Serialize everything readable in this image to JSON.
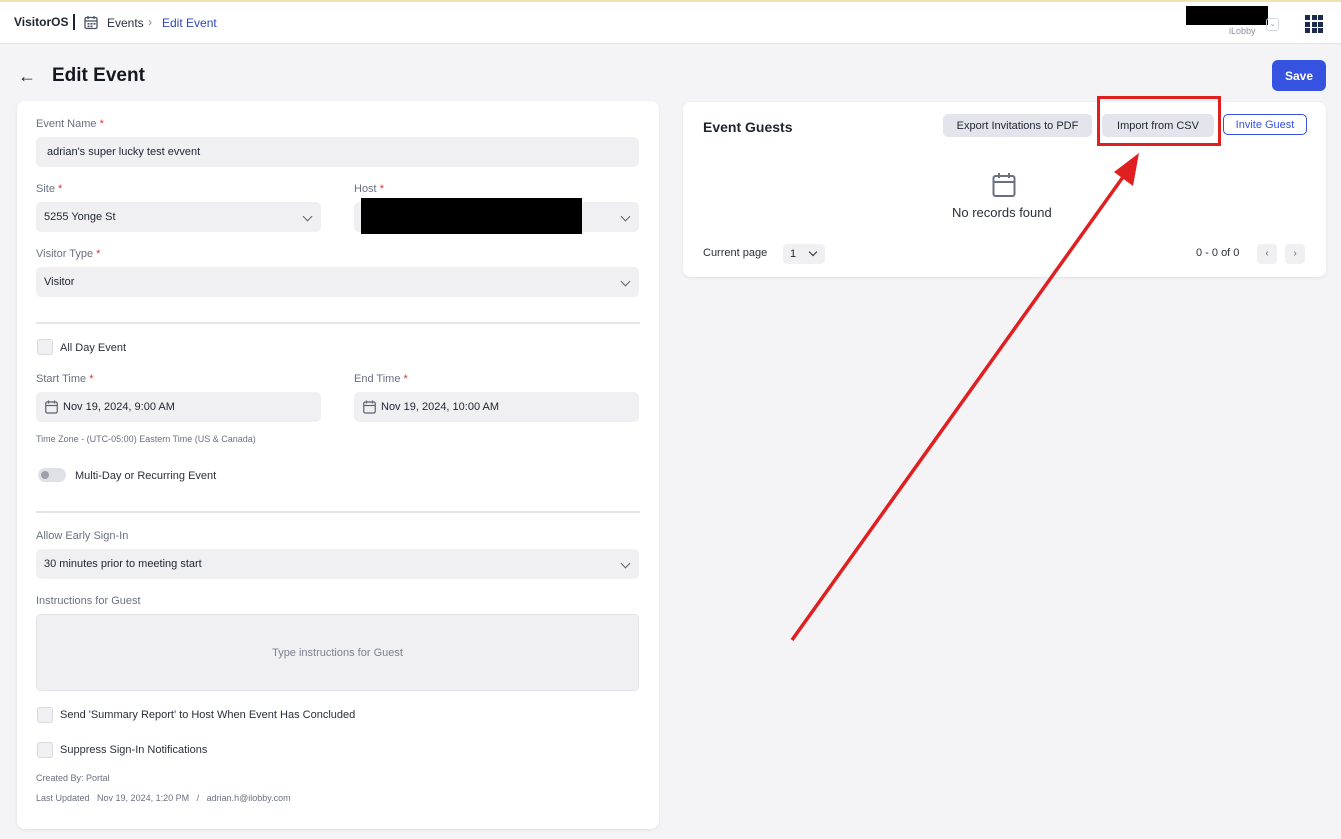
{
  "topbar": {
    "brand": "VisitorOS",
    "breadcrumb_events": "Events",
    "breadcrumb_chevron": "›",
    "breadcrumb_current": "Edit Event",
    "org_label": "iLobby",
    "org_chevron": "⌄"
  },
  "page": {
    "back_arrow": "←",
    "title": "Edit Event",
    "save_label": "Save"
  },
  "form": {
    "event_name_label": "Event Name",
    "event_name_value": "adrian's super lucky test evvent",
    "site_label": "Site",
    "site_value": "5255 Yonge St",
    "host_label": "Host",
    "visitor_type_label": "Visitor Type",
    "visitor_type_value": "Visitor",
    "all_day_label": "All Day Event",
    "start_time_label": "Start Time",
    "start_time_value": "Nov 19, 2024, 9:00 AM",
    "end_time_label": "End Time",
    "end_time_value": "Nov 19, 2024, 10:00 AM",
    "timezone_text": "Time Zone - (UTC-05:00) Eastern Time (US & Canada)",
    "multiday_label": "Multi-Day or Recurring Event",
    "early_signin_label": "Allow Early Sign-In",
    "early_signin_value": "30 minutes prior to meeting start",
    "instructions_label": "Instructions for Guest",
    "instructions_placeholder": "Type instructions for Guest",
    "summary_report_label": "Send 'Summary Report' to Host When Event Has Concluded",
    "suppress_label": "Suppress Sign-In Notifications",
    "created_by": "Created By: Portal",
    "last_updated": "Last Updated   Nov 19, 2024, 1:20 PM   /   adrian.h@ilobby.com",
    "required_mark": "*"
  },
  "guests": {
    "title": "Event Guests",
    "export_label": "Export Invitations to PDF",
    "import_label": "Import from CSV",
    "invite_label": "Invite Guest",
    "empty_text": "No records found",
    "current_page_label": "Current page",
    "current_page_value": "1",
    "range_text": "0 - 0 of 0",
    "prev": "‹",
    "next": "›"
  },
  "colors": {
    "accent": "#3552e0",
    "annotation": "#e02020"
  }
}
